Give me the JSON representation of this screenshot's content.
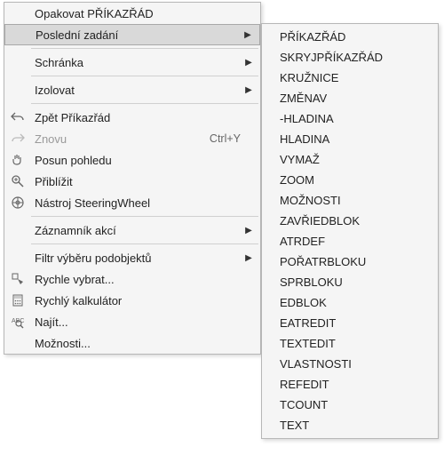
{
  "main_menu": {
    "items": [
      {
        "label": "Opakovat PŘÍKAZŘÁD",
        "icon": null,
        "submenu": false,
        "shortcut": ""
      },
      {
        "label": "Poslední zadání",
        "icon": null,
        "submenu": true,
        "shortcut": "",
        "highlight": true
      },
      {
        "sep": true
      },
      {
        "label": "Schránka",
        "icon": null,
        "submenu": true,
        "shortcut": ""
      },
      {
        "sep": true
      },
      {
        "label": "Izolovat",
        "icon": null,
        "submenu": true,
        "shortcut": ""
      },
      {
        "sep": true
      },
      {
        "label": "Zpět Příkazřád",
        "icon": "undo",
        "submenu": false,
        "shortcut": ""
      },
      {
        "label": "Znovu",
        "icon": "redo",
        "submenu": false,
        "shortcut": "Ctrl+Y",
        "disabled": true
      },
      {
        "label": "Posun pohledu",
        "icon": "pan",
        "submenu": false,
        "shortcut": ""
      },
      {
        "label": "Přiblížit",
        "icon": "zoom",
        "submenu": false,
        "shortcut": ""
      },
      {
        "label": "Nástroj SteeringWheel",
        "icon": "wheel",
        "submenu": false,
        "shortcut": ""
      },
      {
        "sep": true
      },
      {
        "label": "Záznamník akcí",
        "icon": null,
        "submenu": true,
        "shortcut": ""
      },
      {
        "sep": true
      },
      {
        "label": "Filtr výběru podobjektů",
        "icon": null,
        "submenu": true,
        "shortcut": ""
      },
      {
        "label": "Rychle vybrat...",
        "icon": "qselect",
        "submenu": false,
        "shortcut": ""
      },
      {
        "label": "Rychlý kalkulátor",
        "icon": "calc",
        "submenu": false,
        "shortcut": ""
      },
      {
        "label": "Najít...",
        "icon": "find",
        "submenu": false,
        "shortcut": ""
      },
      {
        "label": "Možnosti...",
        "icon": null,
        "submenu": false,
        "shortcut": ""
      }
    ]
  },
  "submenu": {
    "items": [
      "PŘÍKAZŘÁD",
      "SKRYJPŘÍKAZŘÁD",
      "KRUŽNICE",
      "ZMĚNAV",
      "-HLADINA",
      "HLADINA",
      "VYMAŽ",
      "ZOOM",
      "MOŽNOSTI",
      "ZAVŘIEDBLOK",
      "ATRDEF",
      "POŘATRBLOKU",
      "SPRBLOKU",
      "EDBLOK",
      "EATREDIT",
      "TEXTEDIT",
      "VLASTNOSTI",
      "REFEDIT",
      "TCOUNT",
      "TEXT"
    ]
  }
}
